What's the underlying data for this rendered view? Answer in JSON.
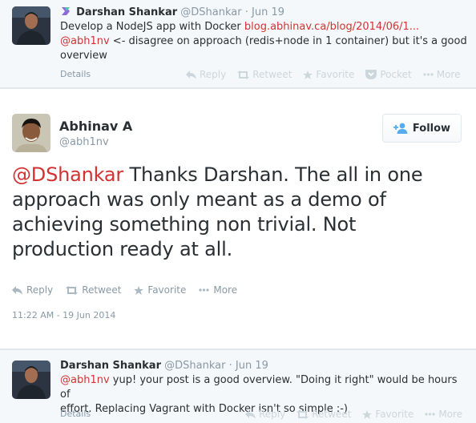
{
  "tweets": {
    "top": {
      "name": "Darshan Shankar",
      "handle": "@DShankar",
      "date": "Jun 19",
      "line1_prefix": "Develop a NodeJS app with Docker ",
      "line1_link": "blog.abhinav.ca/blog/2014/06/1...",
      "line2_mention": "@abh1nv",
      "line2_rest": " <- disagree on approach (redis+node in 1 container) but it's a good",
      "line3": "overview",
      "details": "Details",
      "actions": [
        "Reply",
        "Retweet",
        "Favorite",
        "Pocket",
        "More"
      ]
    },
    "main": {
      "name": "Abhinav A",
      "handle": "@abh1nv",
      "follow_label": "Follow",
      "mention": "@DShankar",
      "text": " Thanks Darshan. The all in one approach was only meant as a demo of achieving something non trivial. Not production ready at all.",
      "actions": [
        "Reply",
        "Retweet",
        "Favorite",
        "More"
      ],
      "timestamp": "11:22 AM - 19 Jun 2014"
    },
    "bottom": {
      "name": "Darshan Shankar",
      "handle": "@DShankar",
      "date": "Jun 19",
      "mention": "@abh1nv",
      "line1_rest": " yup! your post is a good overview. \"Doing it right\" would be hours of",
      "line2": "effort. Replacing Vagrant with Docker isn't so simple :-)",
      "details": "Details",
      "actions": [
        "Reply",
        "Retweet",
        "Favorite",
        "More"
      ]
    }
  },
  "colors": {
    "link": "#d23232",
    "muted": "#8899a6",
    "follow_icon": "#55acee"
  }
}
